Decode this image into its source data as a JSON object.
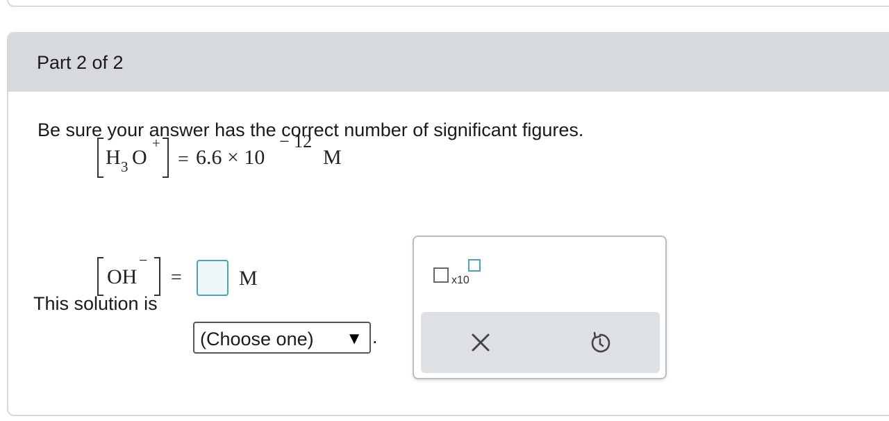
{
  "part_header": {
    "title": "Part 2 of 2"
  },
  "instruction": "Be sure your answer has the correct number of significant figures.",
  "given": {
    "species_main": "H",
    "species_sub": "3",
    "species_main2": "O",
    "charge": "+",
    "equals": "=",
    "value": "6.6 × 10",
    "exponent": "− 12",
    "unit": "M"
  },
  "unknown": {
    "species": "OH",
    "charge": "−",
    "equals": "=",
    "unit": "M"
  },
  "solution": {
    "label": "This solution is",
    "select_value": "(Choose one)",
    "select_arrow": "▼",
    "period": "."
  },
  "tools": {
    "x10_label": "x10",
    "clear_icon": "close-icon",
    "undo_icon": "undo-icon",
    "accent_color": "#4aa4b5"
  }
}
